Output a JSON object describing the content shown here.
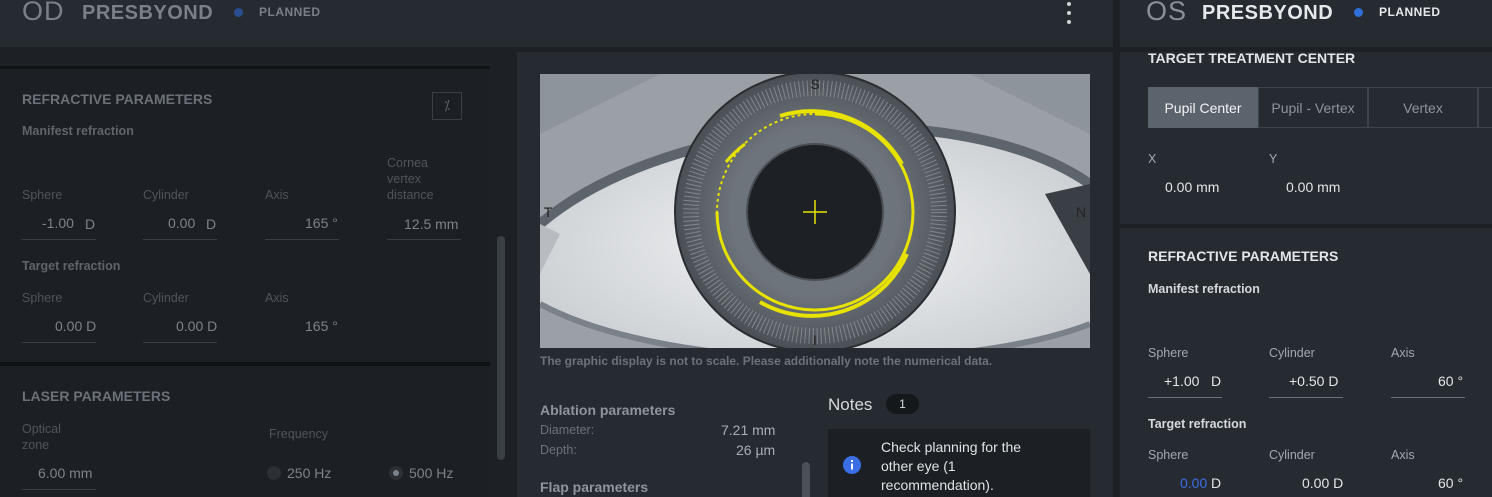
{
  "od_header": {
    "eye": "OD",
    "title": "PRESBYOND",
    "status": "PLANNED",
    "menu_icon": "more-vertical-icon"
  },
  "os_header": {
    "eye": "OS",
    "title": "PRESBYOND",
    "status": "PLANNED"
  },
  "left": {
    "refractive_title": "REFRACTIVE PARAMETERS",
    "manifest_label": "Manifest refraction",
    "manifest": {
      "sphere_label": "Sphere",
      "sphere_value": "-1.00",
      "sphere_unit": "D",
      "cylinder_label": "Cylinder",
      "cylinder_value": "0.00",
      "cylinder_unit": "D",
      "axis_label": "Axis",
      "axis_value": "165 °",
      "vertex_label_1": "Cornea",
      "vertex_label_2": "vertex",
      "vertex_label_3": "distance",
      "vertex_value": "12.5 mm"
    },
    "target_label": "Target refraction",
    "target": {
      "sphere_label": "Sphere",
      "sphere_value": "0.00 D",
      "cylinder_label": "Cylinder",
      "cylinder_value": "0.00 D",
      "axis_label": "Axis",
      "axis_value": "165 °"
    },
    "laser_title": "LASER PARAMETERS",
    "optical_zone_label_1": "Optical",
    "optical_zone_label_2": "zone",
    "optical_zone_value": "6.00 mm",
    "frequency_label": "Frequency",
    "freq_250": "250 Hz",
    "freq_500": "500 Hz"
  },
  "center": {
    "eye_labels": {
      "s": "S",
      "t": "T",
      "n": "N",
      "i": "I"
    },
    "disclaimer": "The graphic display is not to scale. Please additionally note the numerical data.",
    "ablation_title": "Ablation parameters",
    "diameter_label": "Diameter:",
    "diameter_value": "7.21 mm",
    "depth_label": "Depth:",
    "depth_value": "26 µm",
    "flap_title": "Flap parameters",
    "notes_title": "Notes",
    "notes_count": "1",
    "note_text_1": "Check planning for the",
    "note_text_2": "other eye (1",
    "note_text_3": "recommendation)."
  },
  "right": {
    "ttc_title": "TARGET TREATMENT CENTER",
    "tabs": [
      "Pupil Center",
      "Pupil - Vertex",
      "Vertex"
    ],
    "x_label": "X",
    "x_value": "0.00 mm",
    "y_label": "Y",
    "y_value": "0.00 mm",
    "refractive_title": "REFRACTIVE PARAMETERS",
    "manifest_label": "Manifest refraction",
    "manifest": {
      "sphere_label": "Sphere",
      "sphere_value": "+1.00",
      "sphere_unit": "D",
      "cylinder_label": "Cylinder",
      "cylinder_value": "+0.50 D",
      "axis_label": "Axis",
      "axis_value": "60 °"
    },
    "target_label": "Target refraction",
    "target": {
      "sphere_label": "Sphere",
      "sphere_value": "0.00",
      "sphere_unit": "D",
      "cylinder_label": "Cylinder",
      "cylinder_value": "0.00 D",
      "axis_label": "Axis",
      "axis_value": "60 °"
    }
  },
  "colors": {
    "status_blue": "#2f6fd9",
    "ring_yellow": "#e8e200",
    "highlight_blue": "#3b6ee6"
  }
}
